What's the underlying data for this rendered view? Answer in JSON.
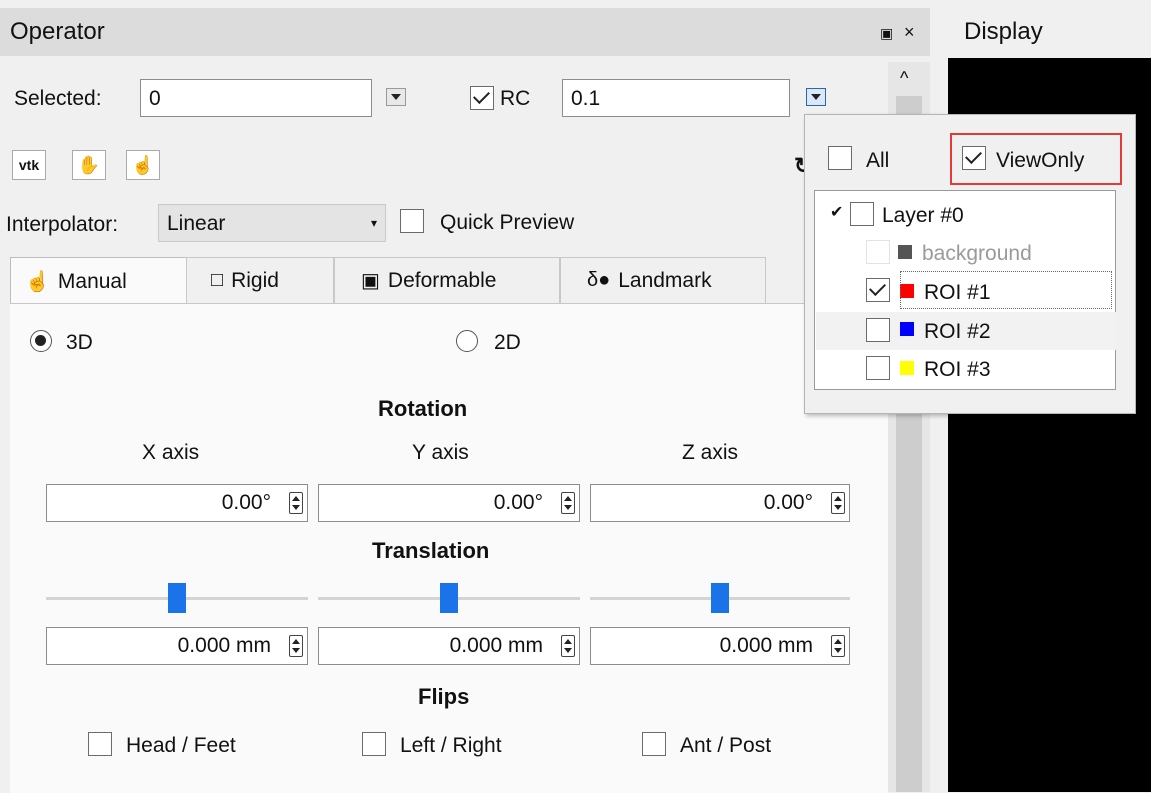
{
  "operator": {
    "title": "Operator",
    "float_icon": "float-icon",
    "close_icon": "close-icon",
    "selected_label": "Selected:",
    "selected_value": "0",
    "roi_label": "RC",
    "roi_value": "0.1",
    "toolbar_vtk_label": "vtk",
    "interpolator_label": "Interpolator:",
    "interpolator_value": "Linear",
    "quick_preview_label": "Quick Preview",
    "tabs": [
      {
        "label": "Manual",
        "icon": "hand-icon"
      },
      {
        "label": "Rigid",
        "icon": "rigid-icon"
      },
      {
        "label": "Deformable",
        "icon": "deformable-icon"
      },
      {
        "label": "Landmark",
        "icon": "landmark-icon"
      }
    ],
    "mode_3d": "3D",
    "mode_2d": "2D",
    "rotation_title": "Rotation",
    "axes": [
      "X axis",
      "Y axis",
      "Z axis"
    ],
    "rotation_values": [
      "0.00°",
      "0.00°",
      "0.00°"
    ],
    "translation_title": "Translation",
    "translation_values": [
      "0.000 mm",
      "0.000 mm",
      "0.000 mm"
    ],
    "translation_slider_levels": [
      0.5,
      0.5,
      0.5
    ],
    "flips_title": "Flips",
    "flips": [
      "Head / Feet",
      "Left / Right",
      "Ant / Post"
    ]
  },
  "display": {
    "title": "Display"
  },
  "popup": {
    "all_label": "All",
    "viewonly_label": "ViewOnly",
    "viewonly_checked": true,
    "layer_label": "Layer #0",
    "items": [
      {
        "label": "background",
        "color": "#555555",
        "checked": false,
        "disabled": true
      },
      {
        "label": "ROI #1",
        "color": "#ff0000",
        "checked": true,
        "disabled": false
      },
      {
        "label": "ROI #2",
        "color": "#0000ff",
        "checked": false,
        "disabled": false
      },
      {
        "label": "ROI #3",
        "color": "#ffff00",
        "checked": false,
        "disabled": false
      }
    ]
  },
  "colors": {
    "accent": "#1a73e8",
    "highlight_border": "#e53935",
    "display_bg": "#000000"
  }
}
